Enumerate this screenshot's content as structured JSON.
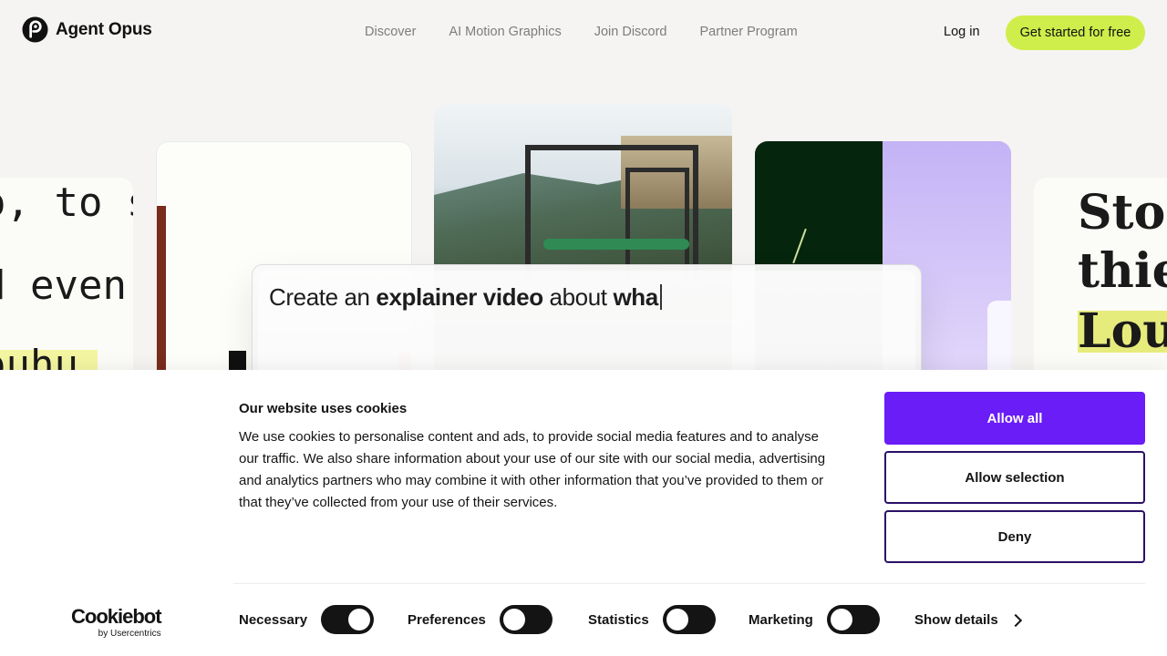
{
  "brand": {
    "name": "Agent Opus",
    "logo_icon": "agent-opus-logo-icon"
  },
  "nav": {
    "items": [
      {
        "label": "Discover"
      },
      {
        "label": "AI Motion Graphics"
      },
      {
        "label": "Join Discord"
      },
      {
        "label": "Partner Program"
      }
    ],
    "login_label": "Log in",
    "cta_label": "Get started for free",
    "cta_color": "#cfee4b"
  },
  "hero": {
    "left_card_lines": [
      "o, to sc",
      "d even",
      "ouhu"
    ],
    "right_card_lines": [
      "Stol",
      "thie",
      "Lou"
    ],
    "prompt": {
      "pre": "Create an ",
      "bold1": "explainer video",
      "mid": " about ",
      "bold2": "wha"
    }
  },
  "cookie_banner": {
    "title": "Our website uses cookies",
    "body": "We use cookies to personalise content and ads, to provide social media features and to analyse our traffic. We also share information about your use of our site with our social media, advertising and analytics partners who may combine it with other information that you’ve provided to them or that they’ve collected from your use of their services.",
    "buttons": {
      "allow_all": "Allow all",
      "allow_selection": "Allow selection",
      "deny": "Deny"
    },
    "accent_color": "#6a1df7",
    "provider": {
      "name": "Cookiebot",
      "sub": "by Usercentrics"
    },
    "toggles": [
      {
        "label": "Necessary",
        "state": "on"
      },
      {
        "label": "Preferences",
        "state": "off"
      },
      {
        "label": "Statistics",
        "state": "off"
      },
      {
        "label": "Marketing",
        "state": "off"
      }
    ],
    "show_details_label": "Show details"
  }
}
